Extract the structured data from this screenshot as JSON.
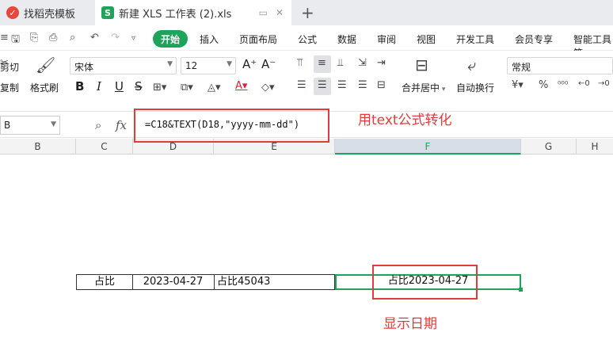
{
  "tabs": {
    "tab1": "找稻壳模板",
    "tab2": "新建 XLS 工作表 (2).xls",
    "tab1_icon": "daoke-logo-icon",
    "tab2_icon": "sheet-s-icon"
  },
  "menu": {
    "items": [
      "开始",
      "插入",
      "页面布局",
      "公式",
      "数据",
      "审阅",
      "视图",
      "开发工具",
      "会员专享",
      "智能工具箱"
    ]
  },
  "ribbon": {
    "cut": "剪切",
    "copy": "复制",
    "format_painter": "格式刷",
    "font_name": "宋体",
    "font_size": "12",
    "merge_center": "合并居中",
    "wrap_text": "自动换行",
    "number_format": "常规"
  },
  "formula_bar": {
    "name_box": "B",
    "formula": "=C18&TEXT(D18,\"yyyy-mm-dd\")",
    "fx": "fx"
  },
  "annotations": {
    "formula_note": "用text公式转化",
    "result_note": "显示日期"
  },
  "columns": [
    "B",
    "C",
    "D",
    "E",
    "F",
    "G",
    "H"
  ],
  "row": {
    "c": "占比",
    "d": "2023-04-27",
    "e": "占比45043",
    "f": "占比2023-04-27"
  },
  "colors": {
    "accent": "#1fa35b",
    "annotation": "#e23b3b"
  }
}
